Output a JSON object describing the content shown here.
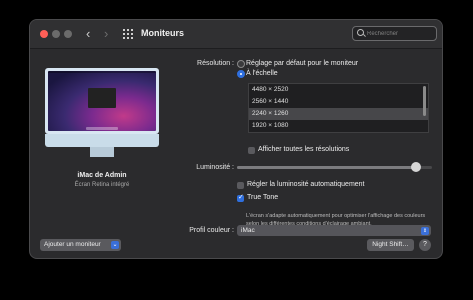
{
  "window": {
    "title": "Moniteurs"
  },
  "search": {
    "placeholder": "Rechercher"
  },
  "display": {
    "name": "iMac de Admin",
    "subtitle": "Écran Retina intégré"
  },
  "buttons": {
    "add_monitor": "Ajouter un moniteur",
    "night_shift": "Night Shift…",
    "help": "?"
  },
  "resolution": {
    "label": "Résolution :",
    "option_default": "Réglage par défaut pour le moniteur",
    "option_scaled": "À l'échelle",
    "selected_option": "scaled",
    "list": [
      "4480 × 2520",
      "2560 × 1440",
      "2240 × 1260",
      "1920 × 1080"
    ],
    "selected_index": 2,
    "show_all_label": "Afficher toutes les résolutions",
    "show_all_checked": false
  },
  "brightness": {
    "label": "Luminosité :",
    "value": 0.92
  },
  "auto_brightness": {
    "label": "Régler la luminosité automatiquement",
    "checked": false
  },
  "true_tone": {
    "label": "True Tone",
    "checked": true,
    "description": "L'écran s'adapte automatiquement pour optimiser l'affichage des couleurs selon les différentes conditions d'éclairage ambiant."
  },
  "color_profile": {
    "label": "Profil couleur :",
    "value": "iMac"
  },
  "colors": {
    "accent": "#2f6fde",
    "window_bg": "#2b2b2d"
  }
}
